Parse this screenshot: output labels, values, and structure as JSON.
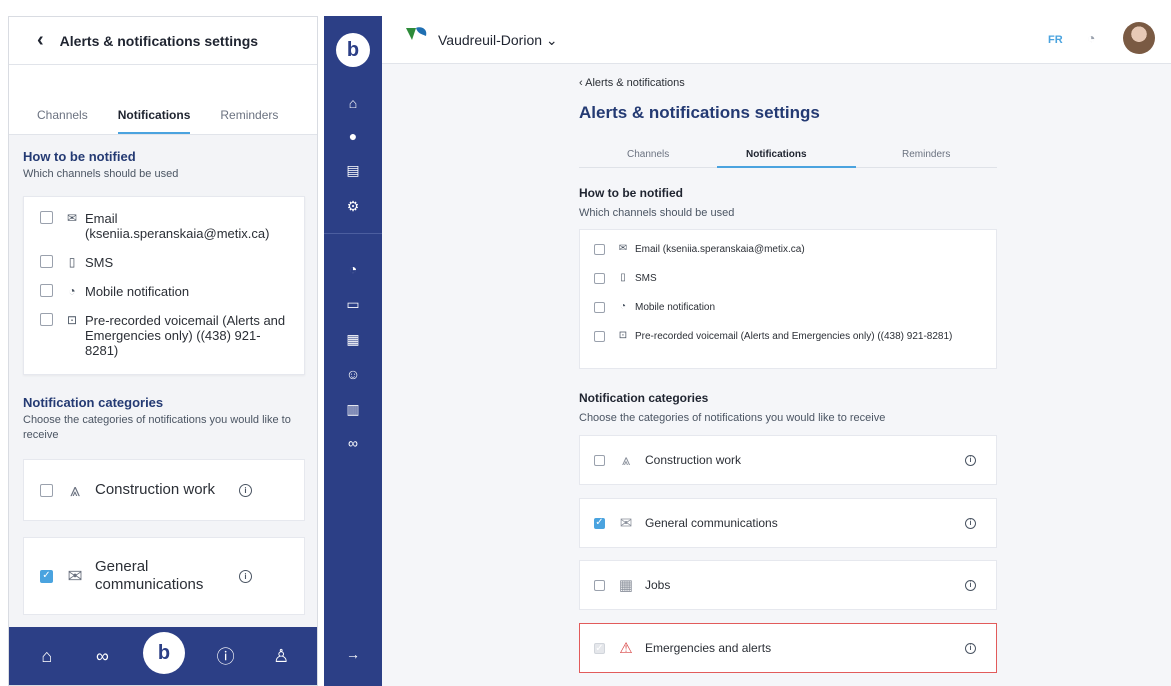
{
  "mobile": {
    "header": {
      "back_icon": "‹",
      "title": "Alerts & notifications settings"
    },
    "tabs": [
      {
        "label": "Channels",
        "active": false
      },
      {
        "label": "Notifications",
        "active": true
      },
      {
        "label": "Reminders",
        "active": false
      }
    ],
    "how": {
      "title": "How to be notified",
      "subtitle": "Which channels should be used"
    },
    "channels": [
      {
        "icon": "email-icon",
        "label": "Email (kseniia.speranskaia@metix.ca)",
        "checked": false
      },
      {
        "icon": "sms-icon",
        "label": "SMS",
        "checked": false
      },
      {
        "icon": "bell-icon",
        "label": "Mobile notification",
        "checked": false
      },
      {
        "icon": "voicemail-icon",
        "label": "Pre-recorded voicemail (Alerts and Emergencies only) ((438) 921-8281)",
        "checked": false
      }
    ],
    "categories_section": {
      "title": "Notification categories",
      "subtitle": "Choose the categories of notifications you would like to receive"
    },
    "categories": [
      {
        "icon": "construction-icon",
        "label": "Construction work",
        "checked": false
      },
      {
        "icon": "envelope-icon",
        "label": "General communications",
        "checked": true
      }
    ],
    "bottom_nav": [
      "home-icon",
      "link-icon",
      "logo",
      "alert-icon",
      "user-icon"
    ]
  },
  "desktop": {
    "city": {
      "name": "Vaudreuil-Dorion ⌄",
      "logo_text": "Vaudreuil Dorion"
    },
    "lang": "FR",
    "breadcrumb": "‹ Alerts & notifications",
    "title": "Alerts & notifications settings",
    "tabs": [
      "Channels",
      "Notifications",
      "Reminders"
    ],
    "how": {
      "title": "How to be notified",
      "subtitle": "Which channels should be used"
    },
    "channels": [
      {
        "icon": "email-icon",
        "label": "Email (kseniia.speranskaia@metix.ca)",
        "checked": false
      },
      {
        "icon": "sms-icon",
        "label": "SMS",
        "checked": false
      },
      {
        "icon": "bell-icon",
        "label": "Mobile notification",
        "checked": false
      },
      {
        "icon": "voicemail-icon",
        "label": "Pre-recorded voicemail (Alerts and Emergencies only) ((438) 921-8281)",
        "checked": false
      }
    ],
    "categories_section": {
      "title": "Notification categories",
      "subtitle": "Choose the categories of notifications you would like to receive"
    },
    "categories": [
      {
        "icon": "construction-icon",
        "label": "Construction work",
        "checked": false,
        "alert": false
      },
      {
        "icon": "envelope-icon",
        "label": "General communications",
        "checked": true,
        "alert": false
      },
      {
        "icon": "building-icon",
        "label": "Jobs",
        "checked": false,
        "alert": false
      },
      {
        "icon": "warning-icon",
        "label": "Emergencies and alerts",
        "checked": true,
        "alert": true,
        "disabled": true
      }
    ]
  },
  "colors": {
    "navy": "#2c3f86",
    "accent": "#4aa3df",
    "alert": "#e25b5b",
    "heading": "#243a73"
  }
}
